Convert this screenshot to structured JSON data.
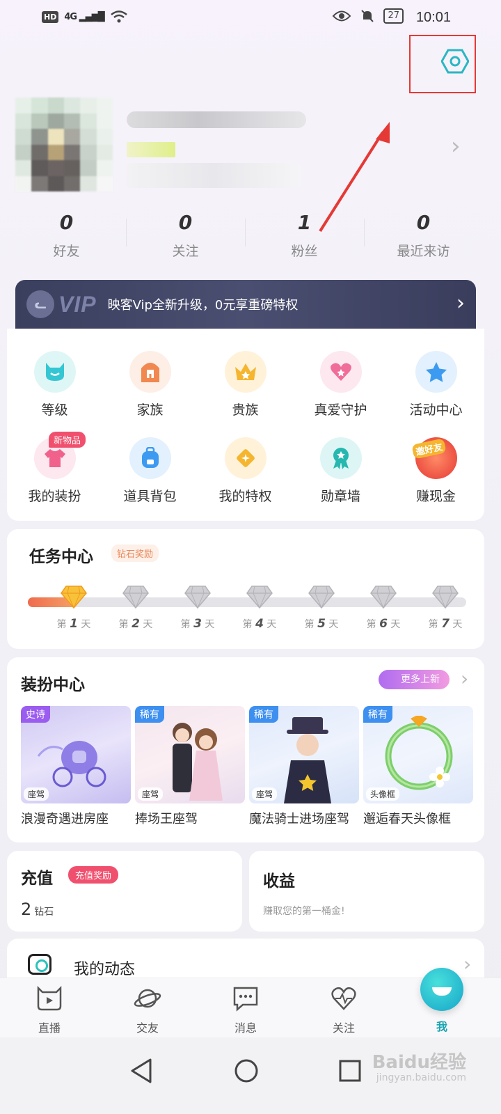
{
  "status_bar": {
    "time": "10:01",
    "battery": "27",
    "network": "4G",
    "hd": "HD"
  },
  "profile": {
    "stats": [
      {
        "value": "0",
        "label": "好友"
      },
      {
        "value": "0",
        "label": "关注"
      },
      {
        "value": "1",
        "label": "粉丝"
      },
      {
        "value": "0",
        "label": "最近来访"
      }
    ]
  },
  "vip_banner": {
    "logo_text": "VIP",
    "text": "映客Vip全新升级，0元享重磅特权"
  },
  "features": {
    "row1": [
      {
        "label": "等级",
        "icon": "level-icon"
      },
      {
        "label": "家族",
        "icon": "family-icon"
      },
      {
        "label": "贵族",
        "icon": "noble-crown-icon"
      },
      {
        "label": "真爱守护",
        "icon": "heart-guard-icon"
      },
      {
        "label": "活动中心",
        "icon": "activity-star-icon"
      }
    ],
    "row2": [
      {
        "label": "我的装扮",
        "icon": "outfit-icon",
        "badge": "新物品"
      },
      {
        "label": "道具背包",
        "icon": "backpack-icon"
      },
      {
        "label": "我的特权",
        "icon": "privilege-icon"
      },
      {
        "label": "勋章墙",
        "icon": "medal-icon"
      },
      {
        "label": "赚现金",
        "icon": "invite-friend-icon",
        "overlay": "邀好友"
      }
    ]
  },
  "task_center": {
    "title": "任务中心",
    "tag": "钻石奖励",
    "days": [
      {
        "prefix": "第",
        "num": "1",
        "suffix": "天"
      },
      {
        "prefix": "第",
        "num": "2",
        "suffix": "天"
      },
      {
        "prefix": "第",
        "num": "3",
        "suffix": "天"
      },
      {
        "prefix": "第",
        "num": "4",
        "suffix": "天"
      },
      {
        "prefix": "第",
        "num": "5",
        "suffix": "天"
      },
      {
        "prefix": "第",
        "num": "6",
        "suffix": "天"
      },
      {
        "prefix": "第",
        "num": "7",
        "suffix": "天"
      }
    ],
    "completed_days": 1
  },
  "dress_center": {
    "title": "装扮中心",
    "more": "更多上新",
    "items": [
      {
        "rarity": "史诗",
        "type": "座驾",
        "name": "浪漫奇遇进房座"
      },
      {
        "rarity": "稀有",
        "type": "座驾",
        "name": "捧场王座驾"
      },
      {
        "rarity": "稀有",
        "type": "座驾",
        "name": "魔法骑士进场座驾"
      },
      {
        "rarity": "稀有",
        "type": "头像框",
        "name": "邂逅春天头像框"
      }
    ]
  },
  "recharge": {
    "title": "充值",
    "tag": "充值奖励",
    "amount": "2",
    "unit": "钻石"
  },
  "earnings": {
    "title": "收益",
    "subtitle": "赚取您的第一桶金!"
  },
  "my_posts": {
    "label": "我的动态"
  },
  "tabbar": [
    {
      "label": "直播"
    },
    {
      "label": "交友"
    },
    {
      "label": "消息"
    },
    {
      "label": "关注"
    },
    {
      "label": "我"
    }
  ],
  "watermark": {
    "main": "Baidu经验",
    "sub": "jingyan.baidu.com"
  },
  "colors": {
    "accent": "#1aa5b3",
    "highlight_box": "#e53935",
    "badge": "#f0506e",
    "vip_bg": "#3b3f5e"
  }
}
